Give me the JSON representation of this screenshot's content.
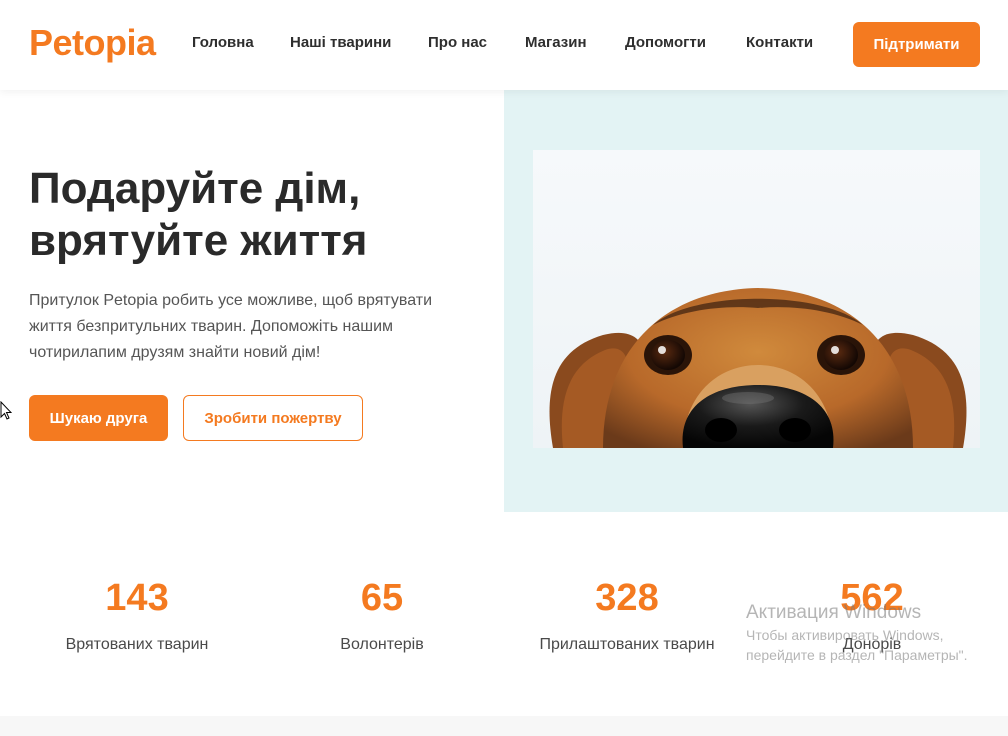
{
  "header": {
    "logo": "Petopia",
    "nav": [
      "Головна",
      "Наші тварини",
      "Про нас",
      "Магазин",
      "Допомогти",
      "Контакти"
    ],
    "support_button": "Підтримати"
  },
  "hero": {
    "title_line1": "Подаруйте дім,",
    "title_line2": "врятуйте життя",
    "description": "Притулок Petopia робить усе можливе, щоб врятувати життя безпритульних тварин. Допоможіть нашим чотирилапим друзям знайти новий дім!",
    "primary_button": "Шукаю друга",
    "secondary_button": "Зробити пожертву",
    "image": "dog-peeking-photo"
  },
  "stats": [
    {
      "value": "143",
      "label": "Врятованих тварин"
    },
    {
      "value": "65",
      "label": "Волонтерів"
    },
    {
      "value": "328",
      "label": "Прилаштованих тварин"
    },
    {
      "value": "562",
      "label": "Донорів"
    }
  ],
  "watermark": {
    "title": "Активация Windows",
    "text": "Чтобы активировать Windows, перейдите в раздел \"Параметры\"."
  },
  "colors": {
    "accent": "#f47a20",
    "hero_panel": "#e3f3f4",
    "heading": "#2a2a2a"
  }
}
